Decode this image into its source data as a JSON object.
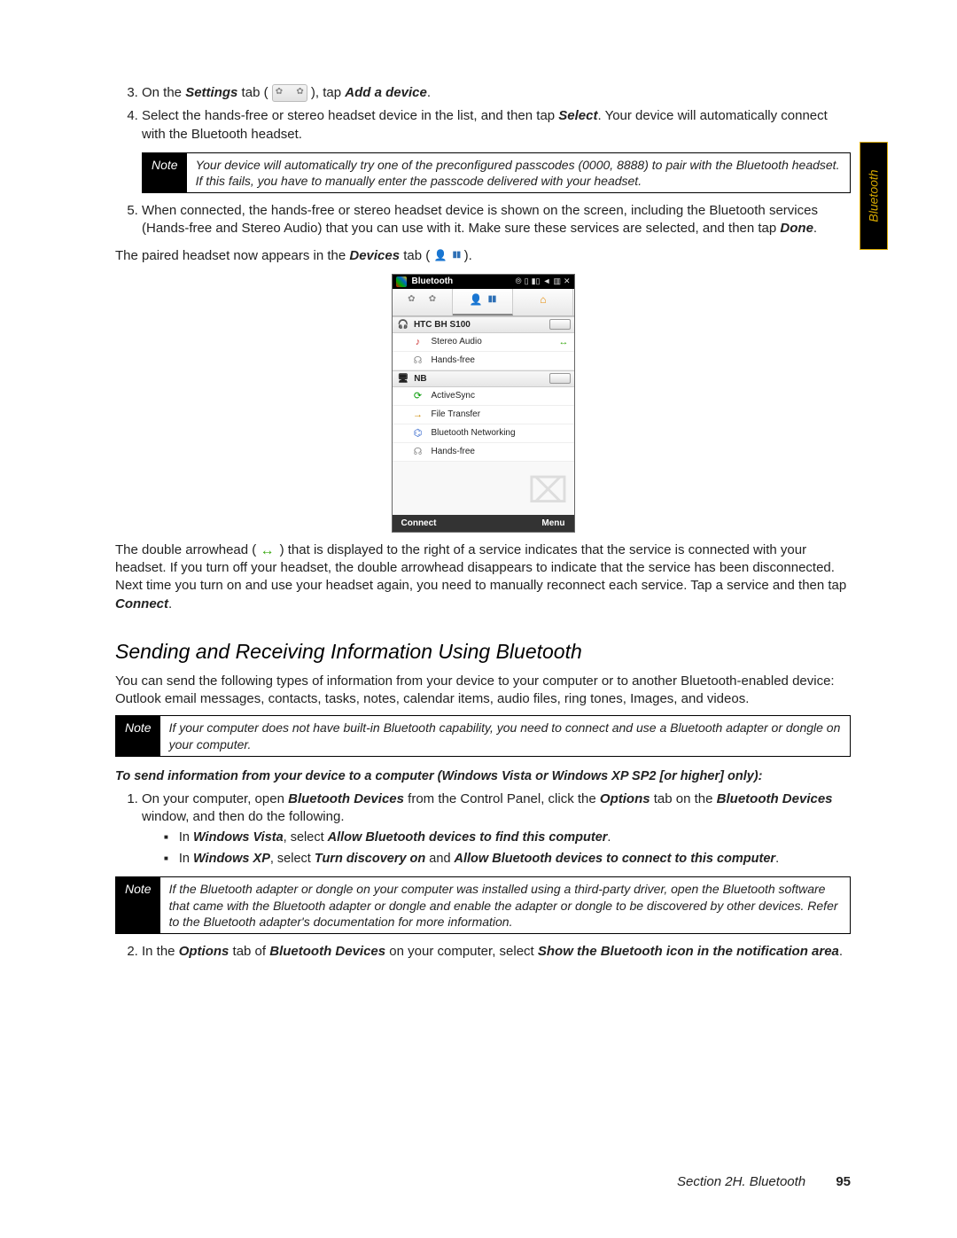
{
  "side_tab": "Bluetooth",
  "steps_a": {
    "s3_pre": "On the ",
    "s3_bold": "Settings",
    "s3_mid": " tab ( ",
    "s3_post": " ), tap ",
    "s3_action": "Add a device",
    "s3_end": ".",
    "s4_a": "Select the hands-free or stereo headset device in the list, and then tap ",
    "s4_b": "Select",
    "s4_c": ". Your device will automatically connect with the Bluetooth headset.",
    "s5_a": "When connected, the hands-free or stereo headset device is shown on the screen, including the Bluetooth services (Hands-free and Stereo Audio) that you can use with it. Make sure these services are selected, and then tap ",
    "s5_b": "Done",
    "s5_c": "."
  },
  "note1": {
    "label": "Note",
    "text": "Your device will automatically try one of the preconfigured passcodes (0000, 8888) to pair with the Bluetooth headset. If this fails, you have to manually enter the passcode delivered with your headset."
  },
  "paired_line": {
    "a": "The paired headset now appears in the ",
    "b": "Devices",
    "c": " tab ( ",
    "d": " )."
  },
  "screenshot": {
    "title": "Bluetooth",
    "device1": "HTC BH S100",
    "svc1a": "Stereo Audio",
    "svc1b": "Hands-free",
    "device2": "NB",
    "svc2a": "ActiveSync",
    "svc2b": "File Transfer",
    "svc2c": "Bluetooth Networking",
    "svc2d": "Hands-free",
    "sk_left": "Connect",
    "sk_right": "Menu"
  },
  "arrow_para": {
    "a": "The double arrowhead ( ",
    "b": " ) that is displayed to the right of a service indicates that the service is connected with your headset. If you turn off your headset, the double arrowhead disappears to indicate that the service has been disconnected. Next time you turn on and use your headset again, you need to manually reconnect each service. Tap a service and then tap ",
    "c": "Connect",
    "d": "."
  },
  "heading": "Sending and Receiving Information Using Bluetooth",
  "intro_para": "You can send the following types of information from your device to your computer or to another Bluetooth-enabled device: Outlook email messages, contacts, tasks, notes, calendar items, audio files, ring tones, Images, and videos.",
  "note2": {
    "label": "Note",
    "text": "If your computer does not have built-in Bluetooth capability, you need to connect and use a Bluetooth adapter or dongle on your computer."
  },
  "sub_instruction": "To send information from your device to a computer (Windows Vista or Windows XP SP2 [or higher] only):",
  "steps_b": {
    "s1_a": "On your computer, open ",
    "s1_b": "Bluetooth Devices",
    "s1_c": " from the Control Panel, click the ",
    "s1_d": "Options",
    "s1_e": " tab on the ",
    "s1_f": "Bluetooth Devices",
    "s1_g": " window, and then do the following.",
    "bullet1_a": "In ",
    "bullet1_b": "Windows Vista",
    "bullet1_c": ", select ",
    "bullet1_d": "Allow Bluetooth devices to find this computer",
    "bullet1_e": ".",
    "bullet2_a": "In ",
    "bullet2_b": "Windows XP",
    "bullet2_c": ", select ",
    "bullet2_d": "Turn discovery on",
    "bullet2_e": " and ",
    "bullet2_f": "Allow Bluetooth devices to connect to this computer",
    "bullet2_g": ".",
    "s2_a": "In the ",
    "s2_b": "Options",
    "s2_c": " tab of ",
    "s2_d": "Bluetooth Devices",
    "s2_e": " on your computer, select ",
    "s2_f": "Show the Bluetooth icon in the notification area",
    "s2_g": "."
  },
  "note3": {
    "label": "Note",
    "text": "If the Bluetooth adapter or dongle on your computer was installed using a third-party driver, open the Bluetooth software that came with the Bluetooth adapter or dongle and enable the adapter or dongle to be discovered by other devices. Refer to the Bluetooth adapter's documentation for more information."
  },
  "footer": {
    "section": "Section 2H. Bluetooth",
    "page": "95"
  }
}
